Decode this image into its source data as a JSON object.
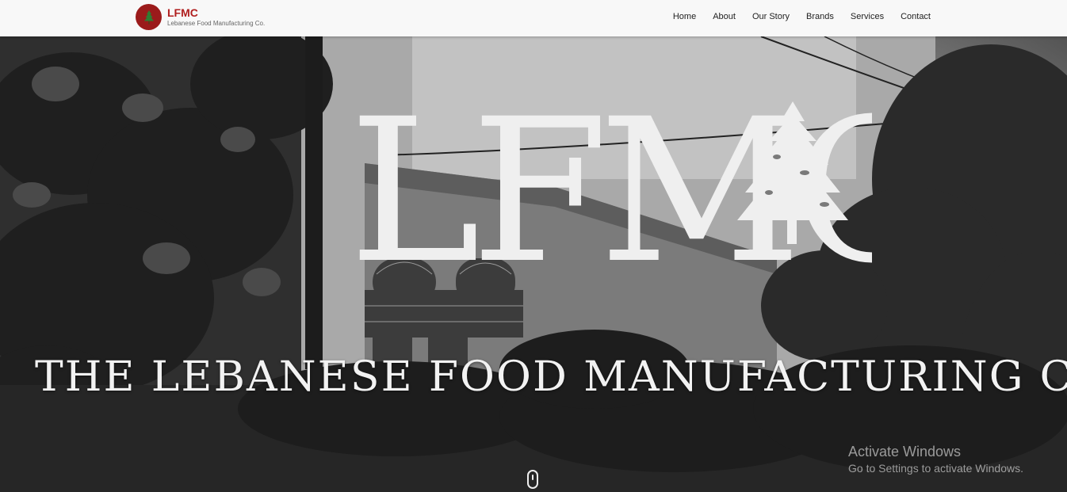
{
  "brand": {
    "name": "LFMC",
    "subtitle": "Lebanese Food Manufacturing Co."
  },
  "nav": [
    {
      "label": "Home"
    },
    {
      "label": "About"
    },
    {
      "label": "Our Story"
    },
    {
      "label": "Brands"
    },
    {
      "label": "Services"
    },
    {
      "label": "Contact"
    }
  ],
  "hero": {
    "logo_text": "LFMC",
    "title": "THE LEBANESE FOOD MANUFACTURING CO."
  },
  "os_watermark": {
    "title": "Activate Windows",
    "subtitle": "Go to Settings to activate Windows."
  },
  "colors": {
    "brand_red": "#b01e1e",
    "logo_circle": "#9b1b1b",
    "navbar_bg": "#f8f8f8"
  },
  "icons": {
    "brand": "cedar-tree-icon",
    "hero": "cedar-tree-icon",
    "scroll": "mouse-scroll-icon"
  }
}
